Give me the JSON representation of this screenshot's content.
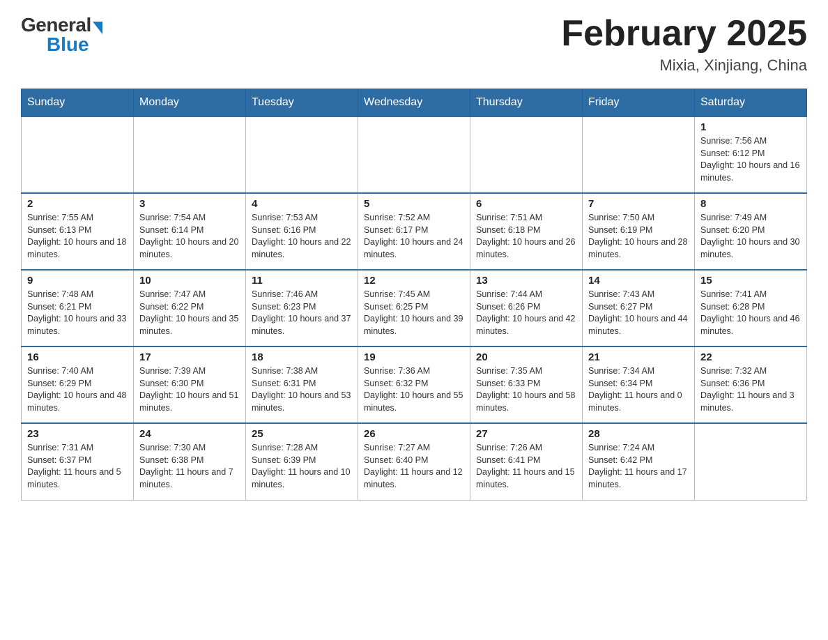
{
  "logo": {
    "general": "General",
    "blue": "Blue"
  },
  "title": "February 2025",
  "location": "Mixia, Xinjiang, China",
  "days_of_week": [
    "Sunday",
    "Monday",
    "Tuesday",
    "Wednesday",
    "Thursday",
    "Friday",
    "Saturday"
  ],
  "weeks": [
    [
      {
        "day": "",
        "info": ""
      },
      {
        "day": "",
        "info": ""
      },
      {
        "day": "",
        "info": ""
      },
      {
        "day": "",
        "info": ""
      },
      {
        "day": "",
        "info": ""
      },
      {
        "day": "",
        "info": ""
      },
      {
        "day": "1",
        "info": "Sunrise: 7:56 AM\nSunset: 6:12 PM\nDaylight: 10 hours and 16 minutes."
      }
    ],
    [
      {
        "day": "2",
        "info": "Sunrise: 7:55 AM\nSunset: 6:13 PM\nDaylight: 10 hours and 18 minutes."
      },
      {
        "day": "3",
        "info": "Sunrise: 7:54 AM\nSunset: 6:14 PM\nDaylight: 10 hours and 20 minutes."
      },
      {
        "day": "4",
        "info": "Sunrise: 7:53 AM\nSunset: 6:16 PM\nDaylight: 10 hours and 22 minutes."
      },
      {
        "day": "5",
        "info": "Sunrise: 7:52 AM\nSunset: 6:17 PM\nDaylight: 10 hours and 24 minutes."
      },
      {
        "day": "6",
        "info": "Sunrise: 7:51 AM\nSunset: 6:18 PM\nDaylight: 10 hours and 26 minutes."
      },
      {
        "day": "7",
        "info": "Sunrise: 7:50 AM\nSunset: 6:19 PM\nDaylight: 10 hours and 28 minutes."
      },
      {
        "day": "8",
        "info": "Sunrise: 7:49 AM\nSunset: 6:20 PM\nDaylight: 10 hours and 30 minutes."
      }
    ],
    [
      {
        "day": "9",
        "info": "Sunrise: 7:48 AM\nSunset: 6:21 PM\nDaylight: 10 hours and 33 minutes."
      },
      {
        "day": "10",
        "info": "Sunrise: 7:47 AM\nSunset: 6:22 PM\nDaylight: 10 hours and 35 minutes."
      },
      {
        "day": "11",
        "info": "Sunrise: 7:46 AM\nSunset: 6:23 PM\nDaylight: 10 hours and 37 minutes."
      },
      {
        "day": "12",
        "info": "Sunrise: 7:45 AM\nSunset: 6:25 PM\nDaylight: 10 hours and 39 minutes."
      },
      {
        "day": "13",
        "info": "Sunrise: 7:44 AM\nSunset: 6:26 PM\nDaylight: 10 hours and 42 minutes."
      },
      {
        "day": "14",
        "info": "Sunrise: 7:43 AM\nSunset: 6:27 PM\nDaylight: 10 hours and 44 minutes."
      },
      {
        "day": "15",
        "info": "Sunrise: 7:41 AM\nSunset: 6:28 PM\nDaylight: 10 hours and 46 minutes."
      }
    ],
    [
      {
        "day": "16",
        "info": "Sunrise: 7:40 AM\nSunset: 6:29 PM\nDaylight: 10 hours and 48 minutes."
      },
      {
        "day": "17",
        "info": "Sunrise: 7:39 AM\nSunset: 6:30 PM\nDaylight: 10 hours and 51 minutes."
      },
      {
        "day": "18",
        "info": "Sunrise: 7:38 AM\nSunset: 6:31 PM\nDaylight: 10 hours and 53 minutes."
      },
      {
        "day": "19",
        "info": "Sunrise: 7:36 AM\nSunset: 6:32 PM\nDaylight: 10 hours and 55 minutes."
      },
      {
        "day": "20",
        "info": "Sunrise: 7:35 AM\nSunset: 6:33 PM\nDaylight: 10 hours and 58 minutes."
      },
      {
        "day": "21",
        "info": "Sunrise: 7:34 AM\nSunset: 6:34 PM\nDaylight: 11 hours and 0 minutes."
      },
      {
        "day": "22",
        "info": "Sunrise: 7:32 AM\nSunset: 6:36 PM\nDaylight: 11 hours and 3 minutes."
      }
    ],
    [
      {
        "day": "23",
        "info": "Sunrise: 7:31 AM\nSunset: 6:37 PM\nDaylight: 11 hours and 5 minutes."
      },
      {
        "day": "24",
        "info": "Sunrise: 7:30 AM\nSunset: 6:38 PM\nDaylight: 11 hours and 7 minutes."
      },
      {
        "day": "25",
        "info": "Sunrise: 7:28 AM\nSunset: 6:39 PM\nDaylight: 11 hours and 10 minutes."
      },
      {
        "day": "26",
        "info": "Sunrise: 7:27 AM\nSunset: 6:40 PM\nDaylight: 11 hours and 12 minutes."
      },
      {
        "day": "27",
        "info": "Sunrise: 7:26 AM\nSunset: 6:41 PM\nDaylight: 11 hours and 15 minutes."
      },
      {
        "day": "28",
        "info": "Sunrise: 7:24 AM\nSunset: 6:42 PM\nDaylight: 11 hours and 17 minutes."
      },
      {
        "day": "",
        "info": ""
      }
    ]
  ]
}
